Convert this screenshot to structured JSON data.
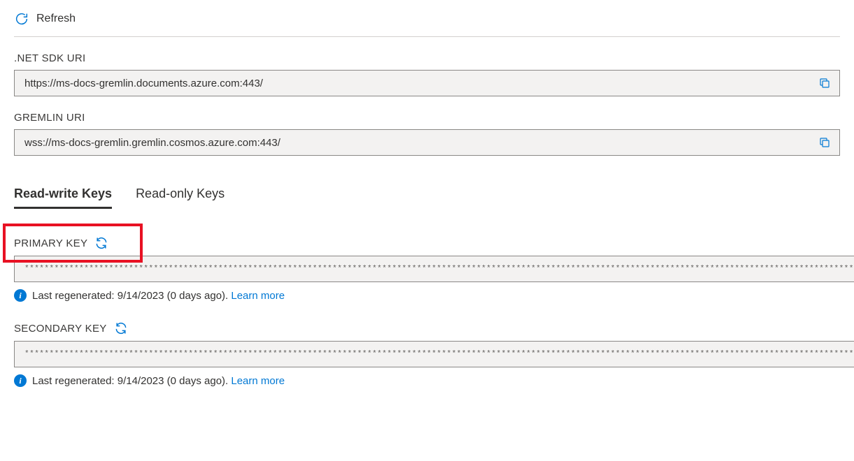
{
  "toolbar": {
    "refresh_label": "Refresh"
  },
  "uris": {
    "net_sdk_label": ".NET SDK URI",
    "net_sdk_value": "https://ms-docs-gremlin.documents.azure.com:443/",
    "gremlin_label": "GREMLIN URI",
    "gremlin_value": "wss://ms-docs-gremlin.gremlin.cosmos.azure.com:443/"
  },
  "tabs": {
    "readwrite": "Read-write Keys",
    "readonly": "Read-only Keys"
  },
  "keys": {
    "primary_label": "PRIMARY KEY",
    "primary_masked": "*************************************************************************************************************************************************************************",
    "primary_info_prefix": "Last regenerated: 9/14/2023 (0 days ago). ",
    "secondary_label": "SECONDARY KEY",
    "secondary_masked": "*************************************************************************************************************************************************************************",
    "secondary_info_prefix": "Last regenerated: 9/14/2023 (0 days ago). ",
    "learn_more": "Learn more"
  }
}
